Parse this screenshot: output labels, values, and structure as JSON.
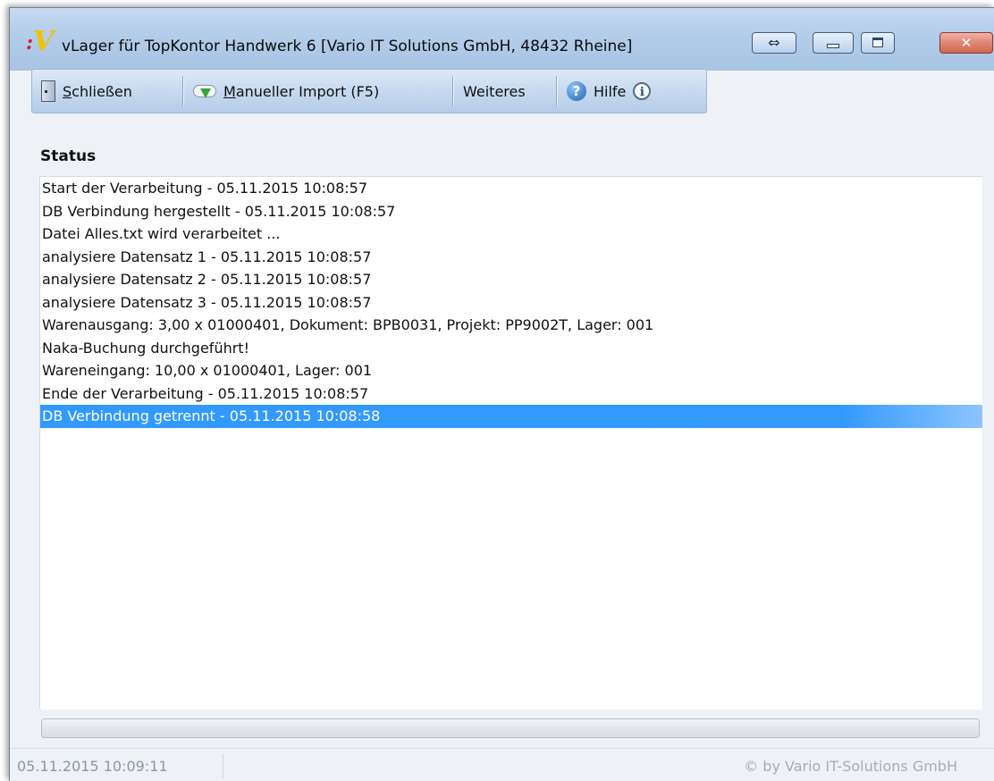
{
  "window": {
    "logo_text": "V",
    "title": "vLager für TopKontor Handwerk 6 [Vario IT Solutions GmbH, 48432 Rheine]",
    "restore_glyph": "⇔",
    "close_glyph": "✕"
  },
  "toolbar": {
    "close_label": "chließen",
    "close_accel": "S",
    "import_accel": "M",
    "import_label": "anueller Import (F5)",
    "more_label": "Weiteres",
    "help_label": "Hilfe",
    "help_glyph": "?",
    "info_glyph": "i"
  },
  "status": {
    "heading": "Status",
    "entries": [
      "Start der Verarbeitung - 05.11.2015 10:08:57",
      "DB Verbindung hergestellt - 05.11.2015 10:08:57",
      "Datei Alles.txt wird verarbeitet ...",
      "analysiere Datensatz 1 - 05.11.2015 10:08:57",
      "analysiere Datensatz 2 - 05.11.2015 10:08:57",
      "analysiere Datensatz 3 - 05.11.2015 10:08:57",
      "Warenausgang: 3,00 x 01000401, Dokument: BPB0031, Projekt: PP9002T, Lager: 001",
      "Naka-Buchung durchgeführt!",
      "Wareneingang: 10,00 x 01000401, Lager: 001",
      "Ende der Verarbeitung - 05.11.2015 10:08:57",
      "DB Verbindung getrennt - 05.11.2015 10:08:58"
    ],
    "selected_index": 10
  },
  "progress": {
    "value": 0
  },
  "statusbar": {
    "datetime": "05.11.2015 10:09:11",
    "copyright": "© by Vario IT-Solutions GmbH"
  },
  "colors": {
    "selection": "#3399ff",
    "titlebar": "#b4cde9",
    "close_button": "#e08a79"
  }
}
